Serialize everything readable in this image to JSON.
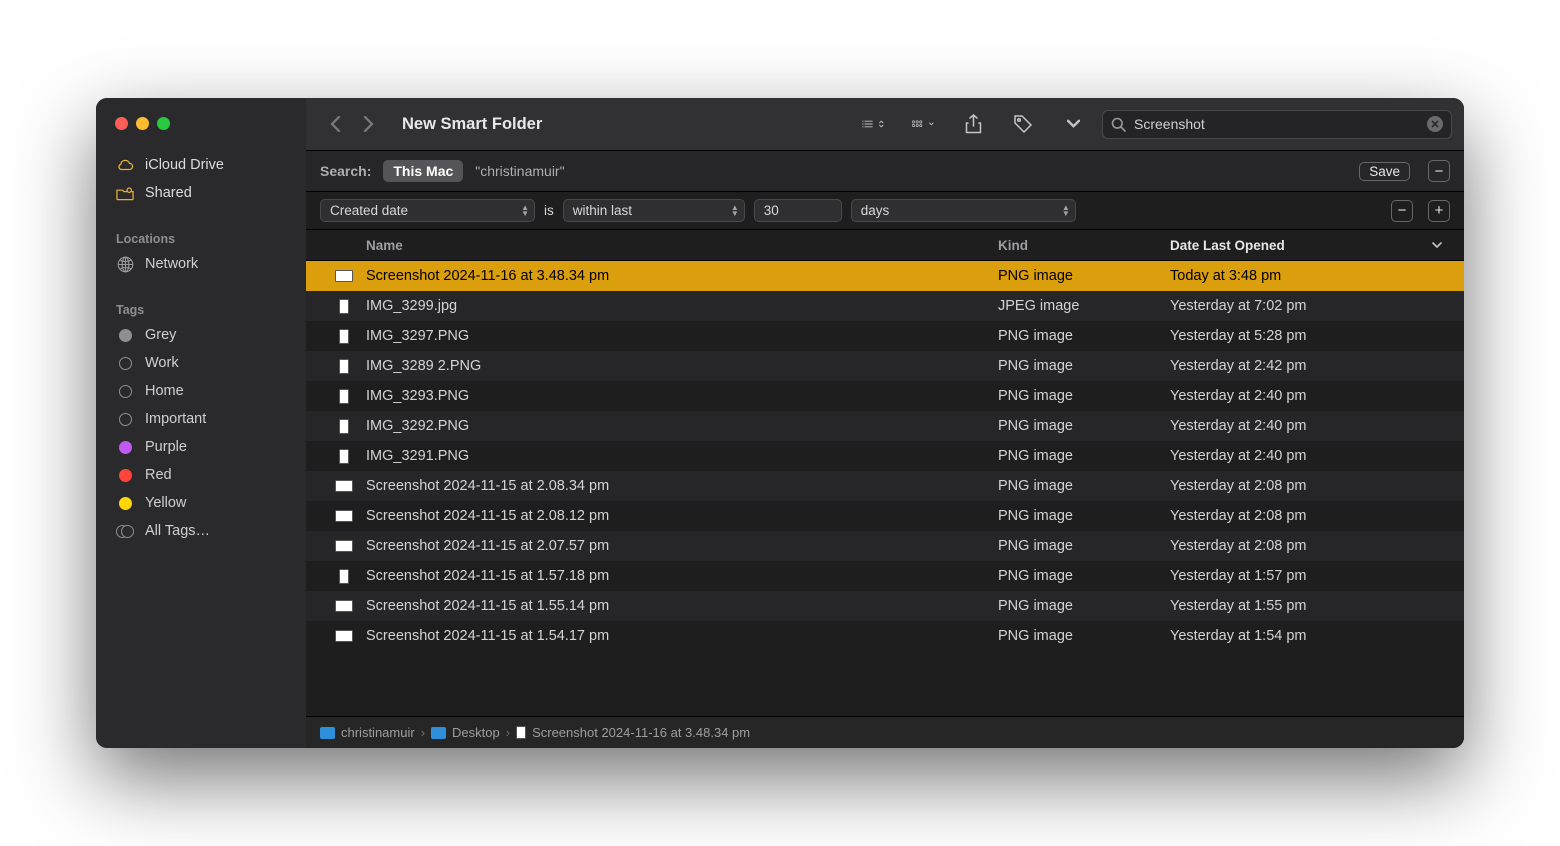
{
  "window_title": "New Smart Folder",
  "search": {
    "value": "Screenshot"
  },
  "sidebar": {
    "favorites": [
      {
        "label": "iCloud Drive",
        "icon": "cloud"
      },
      {
        "label": "Shared",
        "icon": "shared-folder"
      }
    ],
    "locations_header": "Locations",
    "locations": [
      {
        "label": "Network",
        "icon": "globe"
      }
    ],
    "tags_header": "Tags",
    "tags": [
      {
        "label": "Grey",
        "color": "#8e8e92",
        "filled": true
      },
      {
        "label": "Work",
        "color": "#8e8e92",
        "filled": false
      },
      {
        "label": "Home",
        "color": "#8e8e92",
        "filled": false
      },
      {
        "label": "Important",
        "color": "#8e8e92",
        "filled": false
      },
      {
        "label": "Purple",
        "color": "#bf5af2",
        "filled": true
      },
      {
        "label": "Red",
        "color": "#ff453a",
        "filled": true
      },
      {
        "label": "Yellow",
        "color": "#ffd60a",
        "filled": true
      }
    ],
    "all_tags_label": "All Tags…"
  },
  "scope": {
    "label": "Search:",
    "selected": "This Mac",
    "alternative": "\"christinamuir\"",
    "save_label": "Save"
  },
  "criteria": {
    "attribute": "Created date",
    "is_label": "is",
    "operator": "within last",
    "value": "30",
    "unit": "days"
  },
  "columns": {
    "name": "Name",
    "kind": "Kind",
    "date": "Date Last Opened"
  },
  "files": [
    {
      "name": "Screenshot 2024-11-16 at 3.48.34 pm",
      "kind": "PNG image",
      "date": "Today at 3:48 pm",
      "orient": "wide",
      "selected": true
    },
    {
      "name": "IMG_3299.jpg",
      "kind": "JPEG image",
      "date": "Yesterday at 7:02 pm",
      "orient": "tall"
    },
    {
      "name": "IMG_3297.PNG",
      "kind": "PNG image",
      "date": "Yesterday at 5:28 pm",
      "orient": "tall"
    },
    {
      "name": "IMG_3289 2.PNG",
      "kind": "PNG image",
      "date": "Yesterday at 2:42 pm",
      "orient": "tall"
    },
    {
      "name": "IMG_3293.PNG",
      "kind": "PNG image",
      "date": "Yesterday at 2:40 pm",
      "orient": "tall"
    },
    {
      "name": "IMG_3292.PNG",
      "kind": "PNG image",
      "date": "Yesterday at 2:40 pm",
      "orient": "tall"
    },
    {
      "name": "IMG_3291.PNG",
      "kind": "PNG image",
      "date": "Yesterday at 2:40 pm",
      "orient": "tall"
    },
    {
      "name": "Screenshot 2024-11-15 at 2.08.34 pm",
      "kind": "PNG image",
      "date": "Yesterday at 2:08 pm",
      "orient": "wide"
    },
    {
      "name": "Screenshot 2024-11-15 at 2.08.12 pm",
      "kind": "PNG image",
      "date": "Yesterday at 2:08 pm",
      "orient": "wide"
    },
    {
      "name": "Screenshot 2024-11-15 at 2.07.57 pm",
      "kind": "PNG image",
      "date": "Yesterday at 2:08 pm",
      "orient": "wide"
    },
    {
      "name": "Screenshot 2024-11-15 at 1.57.18 pm",
      "kind": "PNG image",
      "date": "Yesterday at 1:57 pm",
      "orient": "tall"
    },
    {
      "name": "Screenshot 2024-11-15 at 1.55.14 pm",
      "kind": "PNG image",
      "date": "Yesterday at 1:55 pm",
      "orient": "wide"
    },
    {
      "name": "Screenshot 2024-11-15 at 1.54.17 pm",
      "kind": "PNG image",
      "date": "Yesterday at 1:54 pm",
      "orient": "wide"
    }
  ],
  "path": [
    {
      "label": "christinamuir",
      "type": "folder",
      "color": "#2e8fda"
    },
    {
      "label": "Desktop",
      "type": "folder",
      "color": "#2e8fda"
    },
    {
      "label": "Screenshot 2024-11-16 at 3.48.34 pm",
      "type": "file"
    }
  ]
}
